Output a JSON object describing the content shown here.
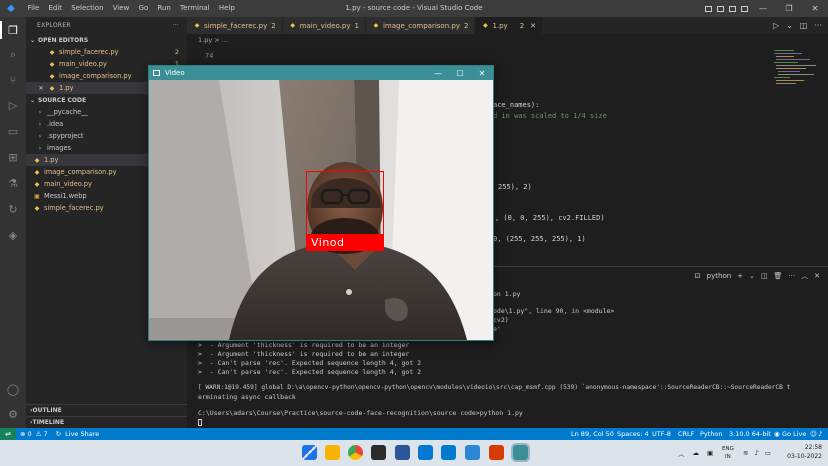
{
  "titlebar": {
    "title": "1.py - source code - Visual Studio Code",
    "menu": [
      "File",
      "Edit",
      "Selection",
      "View",
      "Go",
      "Run",
      "Terminal",
      "Help"
    ],
    "controls": [
      "—",
      "❐",
      "✕"
    ]
  },
  "sidebar": {
    "header": "EXPLORER",
    "header_more": "···",
    "open_editors_label": "OPEN EDITORS",
    "open_editors": [
      {
        "name": "simple_facerec.py",
        "badge": "2"
      },
      {
        "name": "main_video.py",
        "badge": "1"
      },
      {
        "name": "image_comparison.py",
        "badge": "2"
      },
      {
        "name": "1.py",
        "badge": "2"
      }
    ],
    "source_label": "SOURCE CODE",
    "tree": [
      {
        "name": "__pycache__",
        "kind": "folder"
      },
      {
        "name": ".idea",
        "kind": "folder"
      },
      {
        "name": ".spyproject",
        "kind": "folder"
      },
      {
        "name": "images",
        "kind": "folder"
      },
      {
        "name": "1.py",
        "kind": "py"
      },
      {
        "name": "image_comparison.py",
        "kind": "py"
      },
      {
        "name": "main_video.py",
        "kind": "py"
      },
      {
        "name": "Messi1.webp",
        "kind": "image"
      },
      {
        "name": "simple_facerec.py",
        "kind": "py"
      }
    ],
    "outline_label": "OUTLINE",
    "timeline_label": "TIMELINE"
  },
  "tabs": [
    {
      "label": "simple_facerec.py",
      "num": "2",
      "active": false
    },
    {
      "label": "main_video.py",
      "num": "1",
      "active": false
    },
    {
      "label": "image_comparison.py",
      "num": "2",
      "active": false
    },
    {
      "label": "1.py",
      "num": "2",
      "active": true
    }
  ],
  "breadcrumb": "1.py > ...",
  "editor": {
    "line_number": "74",
    "lines": [
      {
        "text": "ace_names):",
        "cls": "c-w"
      },
      {
        "text": "d in was scaled to 1/4 size",
        "cls": "c-g"
      },
      {
        "text": "255), 2)",
        "cls": "c-w"
      },
      {
        "text": ", (0, 0, 255), cv2.FILLED)",
        "cls": "c-w"
      },
      {
        "text": "0, (255, 255, 255), 1)",
        "cls": "c-w"
      }
    ]
  },
  "panel": {
    "shell_label": "python",
    "lines": [
      "on 1.py",
      "ode\\1.py\", line 90, in <module>",
      "cv2)",
      "e'",
      ">  - Argument 'thickness' is required to be an integer",
      ">  - Argument 'thickness' is required to be an integer",
      ">  - Can't parse 'rec'. Expected sequence length 4, got 2",
      ">  - Can't parse 'rec'. Expected sequence length 4, got 2",
      "[ WARN:1@19.459] global D:\\a\\opencv-python\\opencv-python\\opencv\\modules\\videoio\\src\\cap_msmf.cpp (539) `anonymous-namespace'::SourceReaderCB::~SourceReaderCB t",
      "erminating async callback",
      "C:\\Users\\adars\\Course\\Practice\\source-code-face-recognition\\source code>python 1.py"
    ]
  },
  "statusbar": {
    "errors": "⊗ 0",
    "warnings": "⚠ 7",
    "live_share": "Live Share",
    "position": "Ln 89, Col 50",
    "spaces": "Spaces: 4",
    "encoding": "UTF-8",
    "eol": "CRLF",
    "language": "Python",
    "interpreter": "3.10.0 64-bit",
    "go_live": "Go Live"
  },
  "taskbar": {
    "lang": "ENG",
    "region": "IN",
    "time": "22:58",
    "date": "03-10-2022"
  },
  "video_window": {
    "title": "Video",
    "face_label": "Vinod"
  },
  "colors": {
    "accent": "#007acc",
    "face_box": "#ff0000",
    "video_title": "#3a8f96"
  }
}
